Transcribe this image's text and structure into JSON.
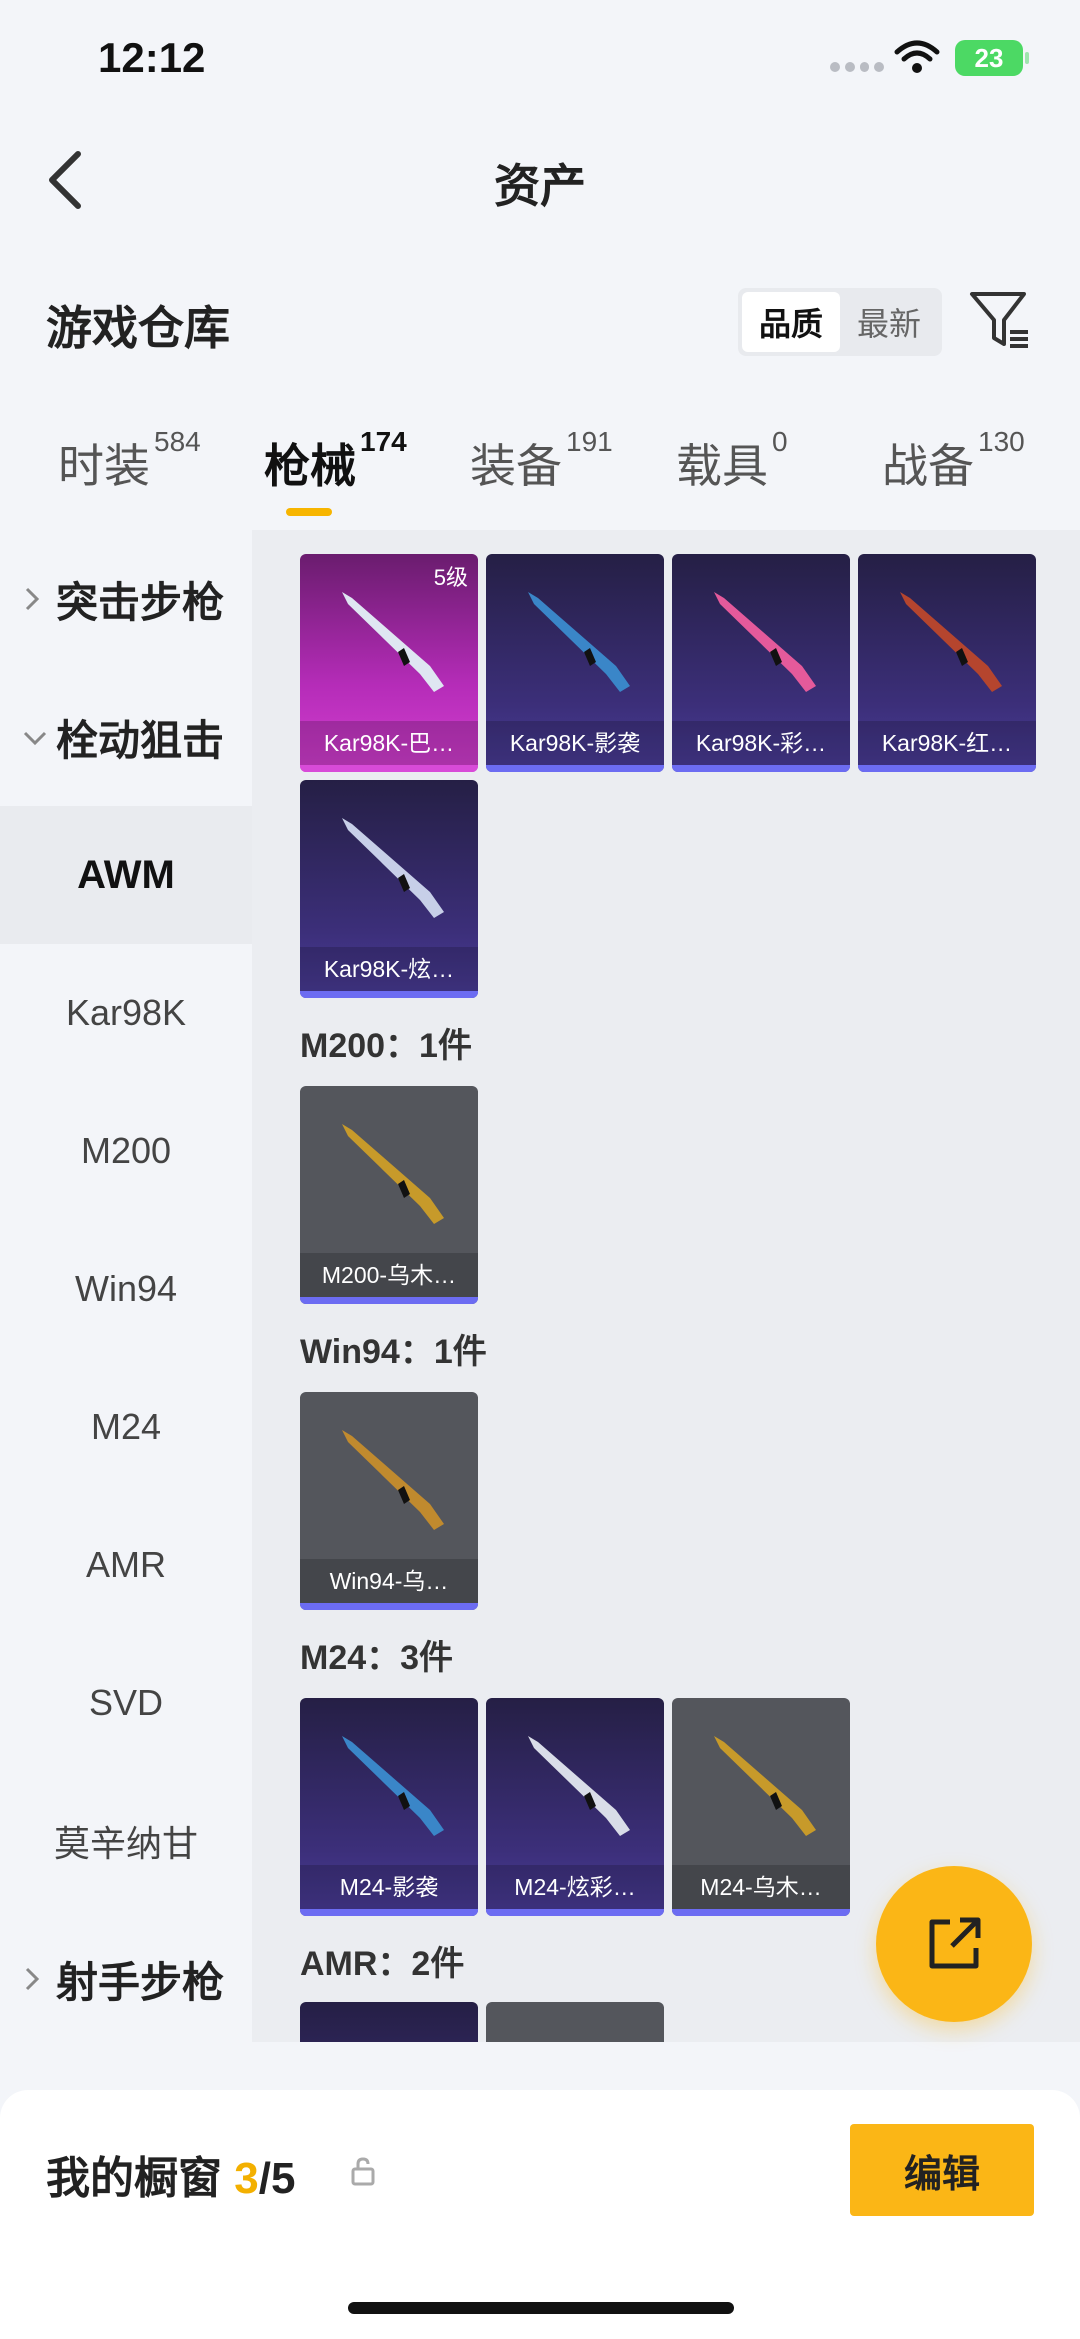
{
  "status": {
    "time": "12:12",
    "battery": "23"
  },
  "nav": {
    "title": "资产"
  },
  "section": {
    "title": "游戏仓库",
    "sort_options": [
      "品质",
      "最新"
    ]
  },
  "tabs": [
    {
      "label": "时装",
      "count": "584"
    },
    {
      "label": "枪械",
      "count": "174"
    },
    {
      "label": "装备",
      "count": "191"
    },
    {
      "label": "载具",
      "count": "0"
    },
    {
      "label": "战备",
      "count": "130"
    }
  ],
  "sidebar": [
    {
      "label": "突击步枪"
    },
    {
      "label": "栓动狙击"
    },
    {
      "label": "AWM"
    },
    {
      "label": "Kar98K"
    },
    {
      "label": "M200"
    },
    {
      "label": "Win94"
    },
    {
      "label": "M24"
    },
    {
      "label": "AMR"
    },
    {
      "label": "SVD"
    },
    {
      "label": "莫辛纳甘"
    },
    {
      "label": "射手步枪"
    }
  ],
  "groups": {
    "m200": "M200：1件",
    "win94": "Win94：1件",
    "m24": "M24：3件",
    "amr": "AMR：2件"
  },
  "cards": [
    {
      "label": "Kar98K-巴…",
      "badge": "5级",
      "rarity": "pink",
      "gun_color": "#dfe6f2"
    },
    {
      "label": "Kar98K-影袭",
      "rarity": "purple",
      "gun_color": "#3a86c8"
    },
    {
      "label": "Kar98K-彩…",
      "rarity": "purple",
      "gun_color": "#e45a9b"
    },
    {
      "label": "Kar98K-红…",
      "rarity": "purple",
      "gun_color": "#b5452e"
    },
    {
      "label": "Kar98K-炫…",
      "rarity": "purple",
      "gun_color": "#c7cfe8"
    },
    {
      "label": "M200-乌木…",
      "rarity": "gray",
      "gun_color": "#c79a2a"
    },
    {
      "label": "Win94-乌…",
      "rarity": "gray",
      "gun_color": "#c08a2e"
    },
    {
      "label": "M24-影袭",
      "rarity": "purple",
      "gun_color": "#3a86c8"
    },
    {
      "label": "M24-炫彩…",
      "rarity": "purple",
      "gun_color": "#d9dde8"
    },
    {
      "label": "M24-乌木…",
      "rarity": "gray",
      "gun_color": "#c79a2a"
    }
  ],
  "bottom": {
    "title": "我的橱窗 ",
    "count_current": "3",
    "count_total": "/5",
    "edit_label": "编辑"
  }
}
